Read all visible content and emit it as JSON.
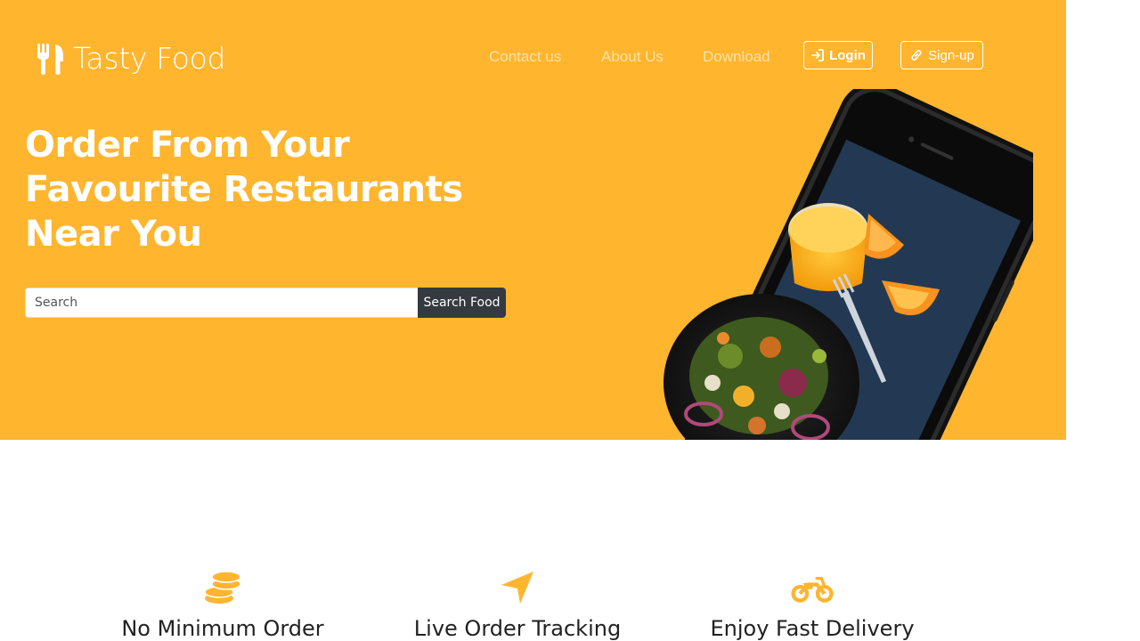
{
  "brand": {
    "name": "Tasty Food",
    "icon": "utensils-icon"
  },
  "nav": {
    "links": [
      "Contact us",
      "About Us",
      "Download"
    ],
    "login_label": "Login",
    "signup_label": "Sign-up"
  },
  "hero": {
    "headline_lines": [
      "Order From Your",
      "Favourite Restaurants",
      "Near You"
    ],
    "search_placeholder": "Search",
    "search_button": "Search Food"
  },
  "features": [
    {
      "icon": "coins-icon",
      "title": "No Minimum Order"
    },
    {
      "icon": "location-arrow-icon",
      "title": "Live Order Tracking"
    },
    {
      "icon": "motorcycle-icon",
      "title": "Enjoy Fast Delivery"
    }
  ],
  "colors": {
    "accent": "#FFB52E",
    "dark_button": "#343A40"
  }
}
